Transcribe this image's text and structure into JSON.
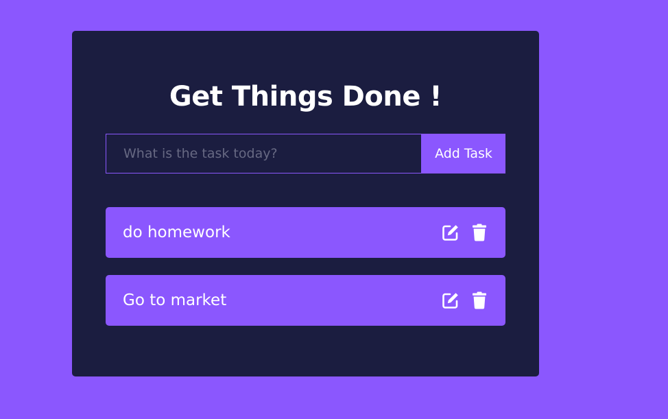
{
  "app": {
    "title": "Get Things Done !"
  },
  "form": {
    "input_value": "",
    "input_placeholder": "What is the task today?",
    "submit_label": "Add Task"
  },
  "todos": [
    {
      "text": "do homework",
      "edit_icon": "edit-icon",
      "delete_icon": "trash-icon"
    },
    {
      "text": "Go to market",
      "edit_icon": "edit-icon",
      "delete_icon": "trash-icon"
    }
  ],
  "colors": {
    "background": "#8b57fe",
    "card": "#1b1d40",
    "accent": "#8b57fe",
    "text": "#ffffff",
    "placeholder": "#676983"
  }
}
